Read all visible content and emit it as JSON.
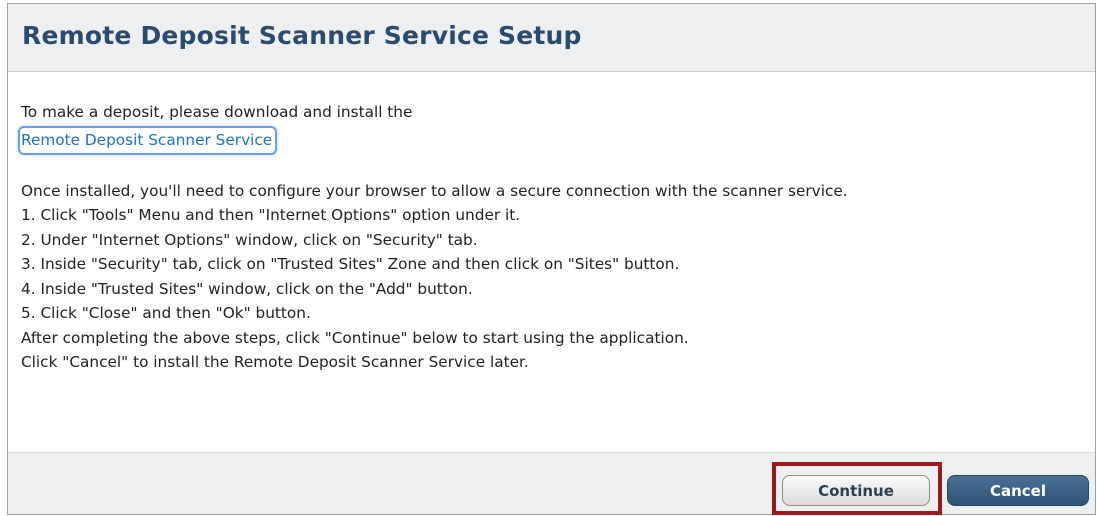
{
  "dialog": {
    "title": "Remote Deposit Scanner Service Setup",
    "intro": "To make a deposit, please download and install the",
    "link_label": "Remote Deposit Scanner Service",
    "instructions": [
      "Once installed, you'll need to configure your browser to allow a secure connection with the scanner service.",
      "1. Click \"Tools\" Menu and then \"Internet Options\" option under it.",
      "2. Under \"Internet Options\" window, click on \"Security\" tab.",
      "3. Inside \"Security\" tab, click on \"Trusted Sites\" Zone and then click on \"Sites\" button.",
      "4. Inside \"Trusted Sites\" window, click on the \"Add\" button.",
      "5. Click \"Close\" and then \"Ok\" button.",
      "After completing the above steps, click \"Continue\" below to start using the application.",
      "Click \"Cancel\" to install the Remote Deposit Scanner Service later."
    ]
  },
  "footer": {
    "continue_label": "Continue",
    "cancel_label": "Cancel"
  },
  "colors": {
    "title": "#2c4a6b",
    "link": "#1f72c6",
    "cancel_button": "#2d5477",
    "highlight": "#9c1a1f"
  }
}
